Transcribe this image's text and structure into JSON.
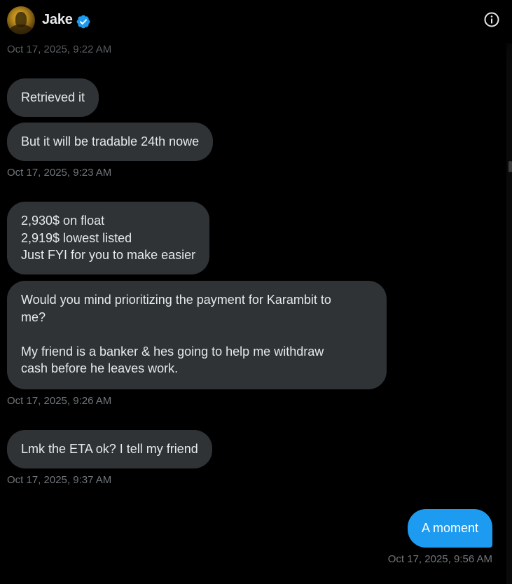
{
  "header": {
    "contact_name": "Jake",
    "verified_icon": "verified-badge-icon",
    "info_icon": "info-icon",
    "colors": {
      "verified": "#1d9bf0",
      "background": "#000000"
    }
  },
  "messages": {
    "ts0": "Oct 17, 2025, 9:22 AM",
    "m1": "Retrieved it",
    "m2": "But it will be tradable 24th nowe",
    "ts1": "Oct 17, 2025, 9:23 AM",
    "m3": "2,930$ on float\n2,919$ lowest listed\nJust FYI for you to make easier",
    "m4": "Would you mind prioritizing the payment for Karambit to\nme?\n\nMy friend is a banker & hes going to help me withdraw\ncash before he leaves work.",
    "ts2": "Oct 17, 2025, 9:26 AM",
    "m5": "Lmk the ETA ok? I tell my friend",
    "ts3": "Oct 17, 2025, 9:37 AM",
    "m6": "A moment",
    "ts4": "Oct 17, 2025, 9:56 AM"
  },
  "colors": {
    "received_bubble": "#2f3336",
    "sent_bubble": "#1d9bf0",
    "timestamp": "#71767b"
  }
}
